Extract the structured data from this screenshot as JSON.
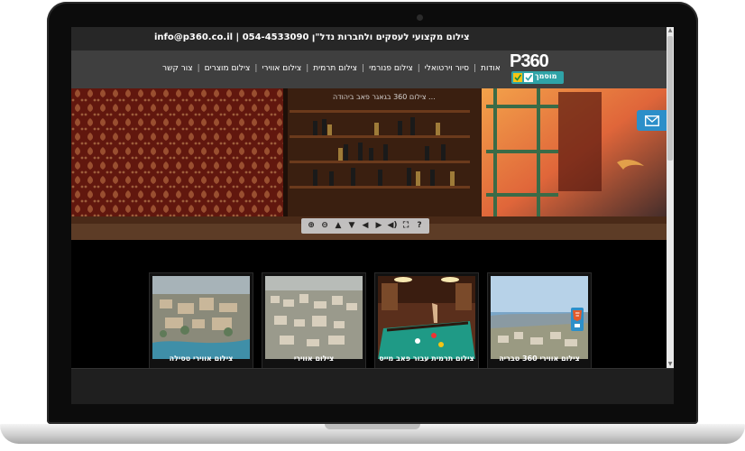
{
  "topbar": {
    "tagline": "צילום מקצועי לעסקים ולחברות נדל\"ן",
    "separator": "|",
    "phone": "054-4533090",
    "email": "info@p360.co.il"
  },
  "logo": {
    "text": "P360",
    "badge_text": "מוסמך"
  },
  "nav": {
    "items": [
      {
        "label": "אודות"
      },
      {
        "label": "סיור וירטואלי"
      },
      {
        "label": "צילום פנורמי"
      },
      {
        "label": "צילום תרמית"
      },
      {
        "label": "צילום אווירי"
      },
      {
        "label": "צילום מוצרים"
      },
      {
        "label": "צור קשר"
      }
    ],
    "separator": "|"
  },
  "panorama": {
    "label": "צילום 360 בגאגר פאב ביהודה ...",
    "controls": [
      {
        "icon": "zoom-in-icon",
        "glyph": "⊕"
      },
      {
        "icon": "zoom-out-icon",
        "glyph": "⊖"
      },
      {
        "icon": "arrow-up-icon",
        "glyph": "▲"
      },
      {
        "icon": "arrow-down-icon",
        "glyph": "▼"
      },
      {
        "icon": "arrow-left-icon",
        "glyph": "◀"
      },
      {
        "icon": "arrow-right-icon",
        "glyph": "▶"
      },
      {
        "icon": "sound-icon",
        "glyph": "◀)"
      },
      {
        "icon": "fullscreen-icon",
        "glyph": "⛶"
      },
      {
        "icon": "help-icon",
        "glyph": "?"
      }
    ]
  },
  "gallery": {
    "cards": [
      {
        "caption": "צילום אווירי טסילה"
      },
      {
        "caption": "צילום אווירי"
      },
      {
        "caption": "צילום תרמית עבור פאב מייס"
      },
      {
        "caption": "צילום אווירי 360 טבריה"
      }
    ]
  },
  "colors": {
    "accent": "#2c8fc9",
    "badge": "#2fa3a7",
    "topbar_bg": "#272727",
    "nav_bg": "#3f3f3f"
  }
}
